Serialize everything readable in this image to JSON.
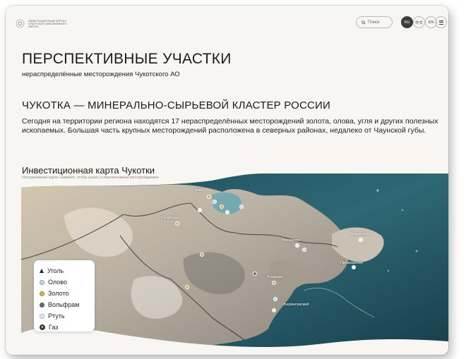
{
  "header": {
    "logo_text": "ИНВЕСТИЦИОННЫЙ ПОРТАЛ ЧУКОТСКОГО АВТОНОМНОГО ОКРУГА",
    "search_label": "Поиск",
    "languages": [
      "RU",
      "中文",
      "EN"
    ],
    "active_language": "RU"
  },
  "hero": {
    "title": "ПЕРСПЕКТИВНЫЕ УЧАСТКИ",
    "subtitle": "нераспределённые месторождения Чукотского АО"
  },
  "section": {
    "title": "ЧУКОТКА — МИНЕРАЛЬНО-СЫРЬЕВОЙ КЛАСТЕР РОССИИ",
    "text": "Сегодня на территории региона находятся 17 нераспределённых месторождений золота, олова, угля и других полезных ископаемых. Большая часть крупных месторождений расположена в северных районах, недалеко от Чаунской губы."
  },
  "map_section": {
    "title": "Инвестиционная карта Чукотки",
    "hint": "Интерактивная карта: нажмите, чтобы узнать о перспективных месторождениях"
  },
  "map": {
    "towns": [
      "Певек",
      "Билибино",
      "Эгвекинот",
      "Лаврентия",
      "Провидения",
      "Анадырь",
      "Беринговский"
    ]
  },
  "legend": {
    "items": [
      {
        "label": "Уголь",
        "color": "#222222"
      },
      {
        "label": "Олово",
        "color": "#bcd8ee"
      },
      {
        "label": "Золото",
        "color": "#d7b25a"
      },
      {
        "label": "Вольфрам",
        "color": "#5f6f83"
      },
      {
        "label": "Ртуть",
        "color": "#ecebe8"
      },
      {
        "label": "Газ",
        "color": "#3a3a3a"
      }
    ]
  }
}
